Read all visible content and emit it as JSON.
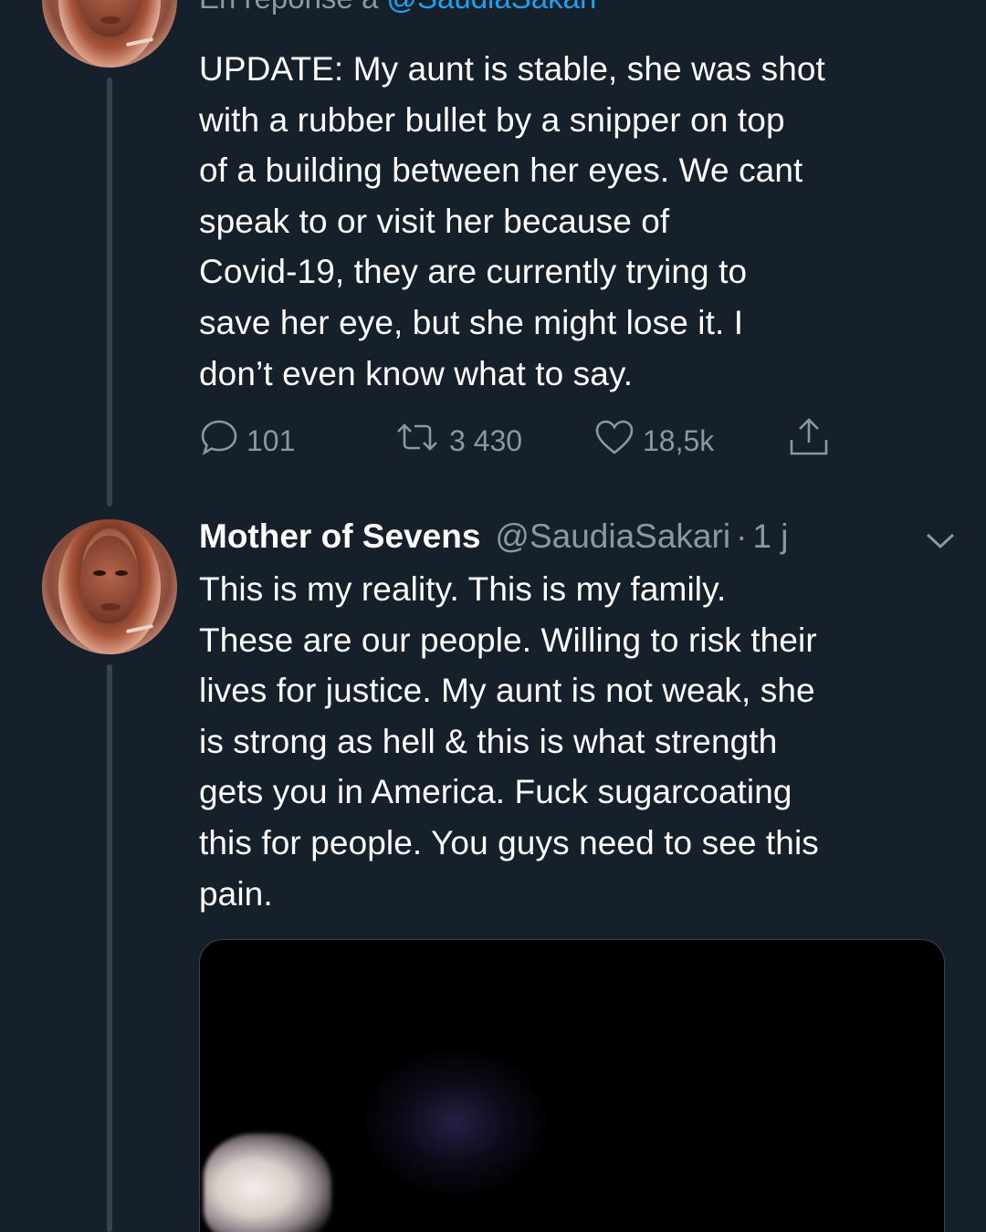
{
  "first_tweet": {
    "reply_prefix": "En réponse à ",
    "reply_mention": "@SaudiaSakari",
    "text": "UPDATE: My aunt is stable, she was shot\nwith a rubber bullet by a snipper on top\nof a building between her eyes. We cant\nspeak to or visit her because of\nCovid-19, they are currently trying to\nsave her eye, but she might lose it. I\ndon’t even know what to say.",
    "actions": {
      "reply_count": "101",
      "retweet_count": "3 430",
      "like_count": "18,5k",
      "reply_icon": "comment-icon",
      "retweet_icon": "retweet-icon",
      "like_icon": "heart-icon",
      "share_icon": "share-icon"
    }
  },
  "second_tweet": {
    "display_name": "Mother of Sevens",
    "handle": "@SaudiaSakari",
    "separator": "·",
    "time": "1 j",
    "menu_icon": "chevron-down-icon",
    "text": "This is my reality. This is my family.\nThese are our people. Willing to risk their\nlives for justice. My aunt is not weak, she\nis strong as hell & this is what strength\ngets you in America. Fuck sugarcoating\nthis for people. You guys need to see this\npain."
  },
  "colors": {
    "background": "#15202b",
    "secondary_text": "#8899a6",
    "link": "#1da1f2",
    "thread_line": "#38444d"
  }
}
